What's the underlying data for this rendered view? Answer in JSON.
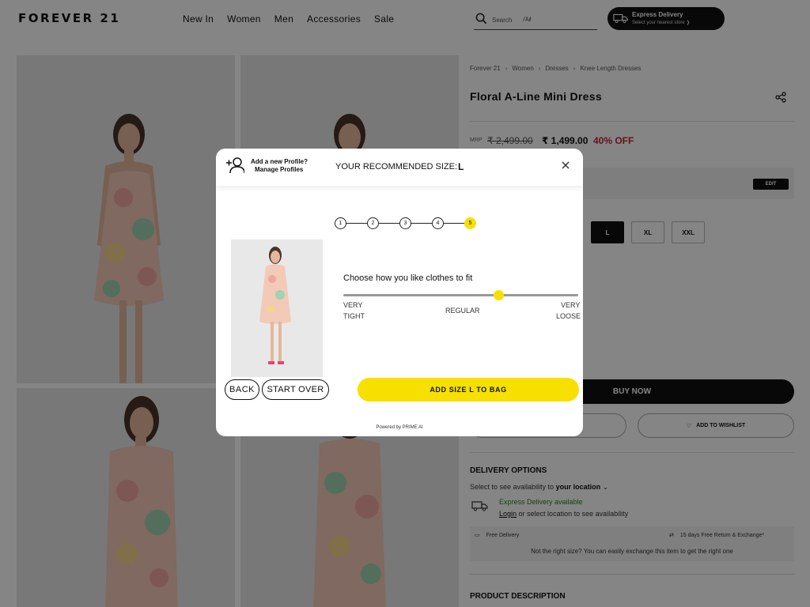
{
  "header": {
    "logo": "FOREVER 21",
    "nav": [
      "New In",
      "Women",
      "Men",
      "Accessories",
      "Sale"
    ],
    "search_placeholder": "Search",
    "search_typed": "ꤷꤸꤹ",
    "express_title": "Express Delivery",
    "express_sub": "Select your nearest store ❯"
  },
  "product": {
    "breadcrumbs": [
      "Forever 21",
      "Women",
      "Dresses",
      "Knee Length Dresses"
    ],
    "title": "Floral A-Line Mini Dress",
    "mrp_label": "MRP",
    "original_price": "₹ 2,499.00",
    "price": "₹ 1,499.00",
    "discount": "40% OFF",
    "edit_label": "EDIT",
    "sizes": [
      "L",
      "XL",
      "XXL"
    ],
    "selected_size": "L",
    "buy_now": "BUY NOW",
    "wishlist": "ADD TO WISHLIST"
  },
  "delivery": {
    "heading": "DELIVERY OPTIONS",
    "select_prefix": "Select to see availability to",
    "select_location": "your location",
    "express_available": "Express Delivery available",
    "login_link": "Login",
    "login_suffix": "or select location to see availability",
    "free_delivery": "Free Delivery",
    "return_exchange": "15 days Free Return & Exchange*",
    "exchange_note": "Not the right size? You can easily exchange this item to get the right one"
  },
  "description_heading": "PRODUCT DESCRIPTION",
  "modal": {
    "add_profile": "Add a new Profile?",
    "manage_profiles": "Manage Profiles",
    "recommended_label": "YOUR RECOMMENDED SIZE:",
    "recommended_size": "L",
    "steps": [
      "1",
      "2",
      "3",
      "4",
      "5"
    ],
    "current_step": 5,
    "fit_question": "Choose how you like clothes to fit",
    "fit_value_fraction": 0.66,
    "fit_left_1": "VERY",
    "fit_left_2": "TIGHT",
    "fit_mid": "REGULAR",
    "fit_right_1": "VERY",
    "fit_right_2": "LOOSE",
    "back": "BACK",
    "start_over": "START OVER",
    "add_to_bag": "ADD SIZE L TO BAG",
    "powered_by": "Powered by PRIME AI"
  },
  "colors": {
    "accent_yellow": "#f7e000",
    "discount_red": "#c0272d",
    "available_green": "#2a7d2a"
  }
}
